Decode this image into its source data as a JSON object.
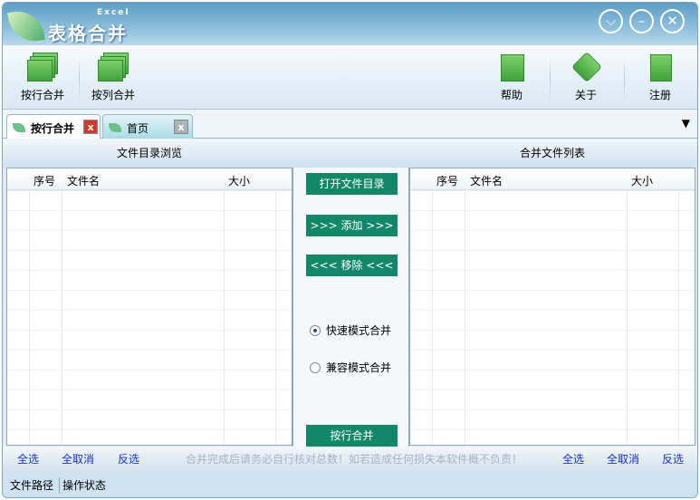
{
  "app": {
    "title": "表格合并",
    "subtitle": "Excel"
  },
  "window_buttons": [
    "dropdown-icon",
    "minimize-icon",
    "close-icon"
  ],
  "toolbar": {
    "by_row": "按行合并",
    "by_col": "按列合并",
    "help": "帮助",
    "about": "关于",
    "register": "注册"
  },
  "tabs": [
    {
      "label": "按行合并",
      "active": true
    },
    {
      "label": "首页",
      "active": false
    }
  ],
  "left_panel": {
    "title": "文件目录浏览",
    "columns": [
      "序号",
      "文件名",
      "大小"
    ],
    "rows": []
  },
  "right_panel": {
    "title": "合并文件列表",
    "columns": [
      "序号",
      "文件名",
      "大小"
    ],
    "rows": []
  },
  "center": {
    "open_dir": "打开文件目录",
    "add": ">>> 添加 >>>",
    "remove": "<<< 移除 <<<",
    "modes": [
      {
        "label": "快速模式合并",
        "checked": true
      },
      {
        "label": "兼容模式合并",
        "checked": false
      }
    ],
    "merge": "按行合并"
  },
  "footer": {
    "select_all": "全选",
    "deselect_all": "全取消",
    "invert": "反选",
    "notice": "合并完成后请务必自行核对总数！如若造成任何损失本软件概不负责！"
  },
  "status": {
    "path": "文件路径",
    "state": "操作状态"
  }
}
